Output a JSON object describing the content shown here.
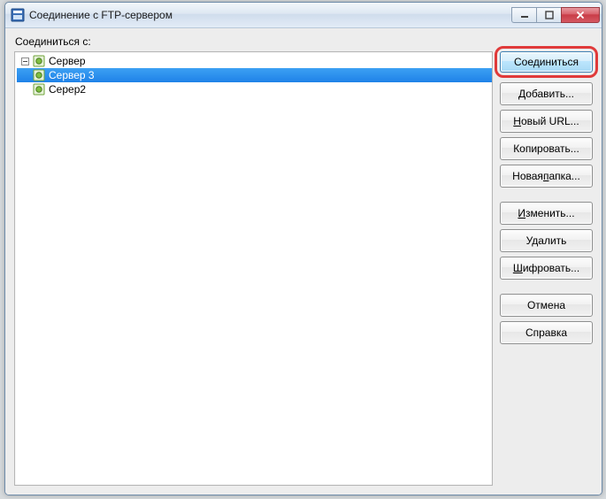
{
  "window": {
    "title": "Соединение с FTP-сервером"
  },
  "label": "Соединиться с:",
  "tree": {
    "items": [
      {
        "label": "Сервер",
        "selected": false
      },
      {
        "label": "Сервер 3",
        "selected": true
      },
      {
        "label": "Серер2",
        "selected": false
      }
    ]
  },
  "buttons": {
    "connect": "Соединиться",
    "add": "Добавить...",
    "new_url_prefix": "Н",
    "new_url_rest": "овый URL...",
    "copy": "Копировать...",
    "new_folder_prefix": "Новая ",
    "new_folder_u": "п",
    "new_folder_rest": "апка...",
    "edit_u": "И",
    "edit_rest": "зменить...",
    "delete": "Удалить",
    "encrypt_u": "Ш",
    "encrypt_rest": "ифровать...",
    "cancel": "Отмена",
    "help": "Справка"
  }
}
